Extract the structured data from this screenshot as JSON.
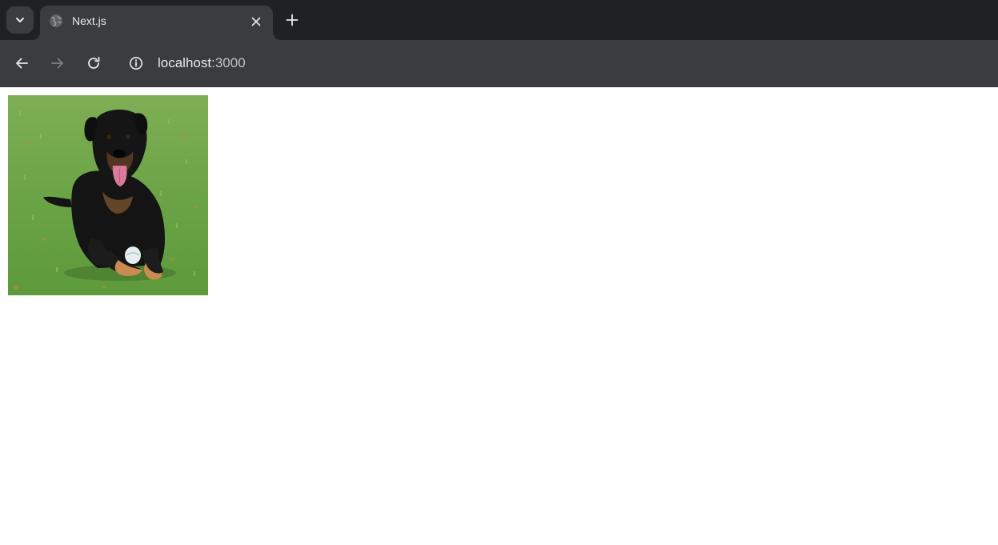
{
  "browser": {
    "tab": {
      "title": "Next.js",
      "favicon": "globe-icon"
    },
    "address_bar": {
      "host": "localhost",
      "port": ":3000"
    },
    "icons": {
      "tab_search": "chevron-down-icon",
      "tab_close": "close-icon",
      "new_tab": "plus-icon",
      "back": "arrow-left-icon",
      "forward": "arrow-right-icon",
      "reload": "reload-icon",
      "site_info": "info-icon"
    },
    "colors": {
      "tabstrip_bg": "#202124",
      "toolbar_bg": "#3b3c3f",
      "text": "#e8eaed",
      "disabled_icon": "#7d7f82"
    }
  },
  "page": {
    "image": {
      "subject": "photo"
    }
  }
}
